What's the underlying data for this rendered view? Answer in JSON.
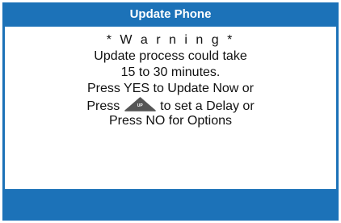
{
  "colors": {
    "accent": "#1c72b8",
    "background": "#ffffff",
    "text": "#111111",
    "key_fill": "#555555",
    "key_label": "#ffffff"
  },
  "header": {
    "title": "Update Phone"
  },
  "dialog": {
    "warning": "* W a r n i n g *",
    "line_2": "Update process could take",
    "line_3": "15 to 30 minutes.",
    "line_4": "Press YES to Update Now or",
    "line_5_before_key": "Press",
    "line_5_key_label": "UP",
    "line_5_key_icon": "up-arrow-key-icon",
    "line_5_after_key": "to set a Delay or",
    "line_6": "Press NO for Options"
  },
  "footer": {
    "softkeys": []
  }
}
